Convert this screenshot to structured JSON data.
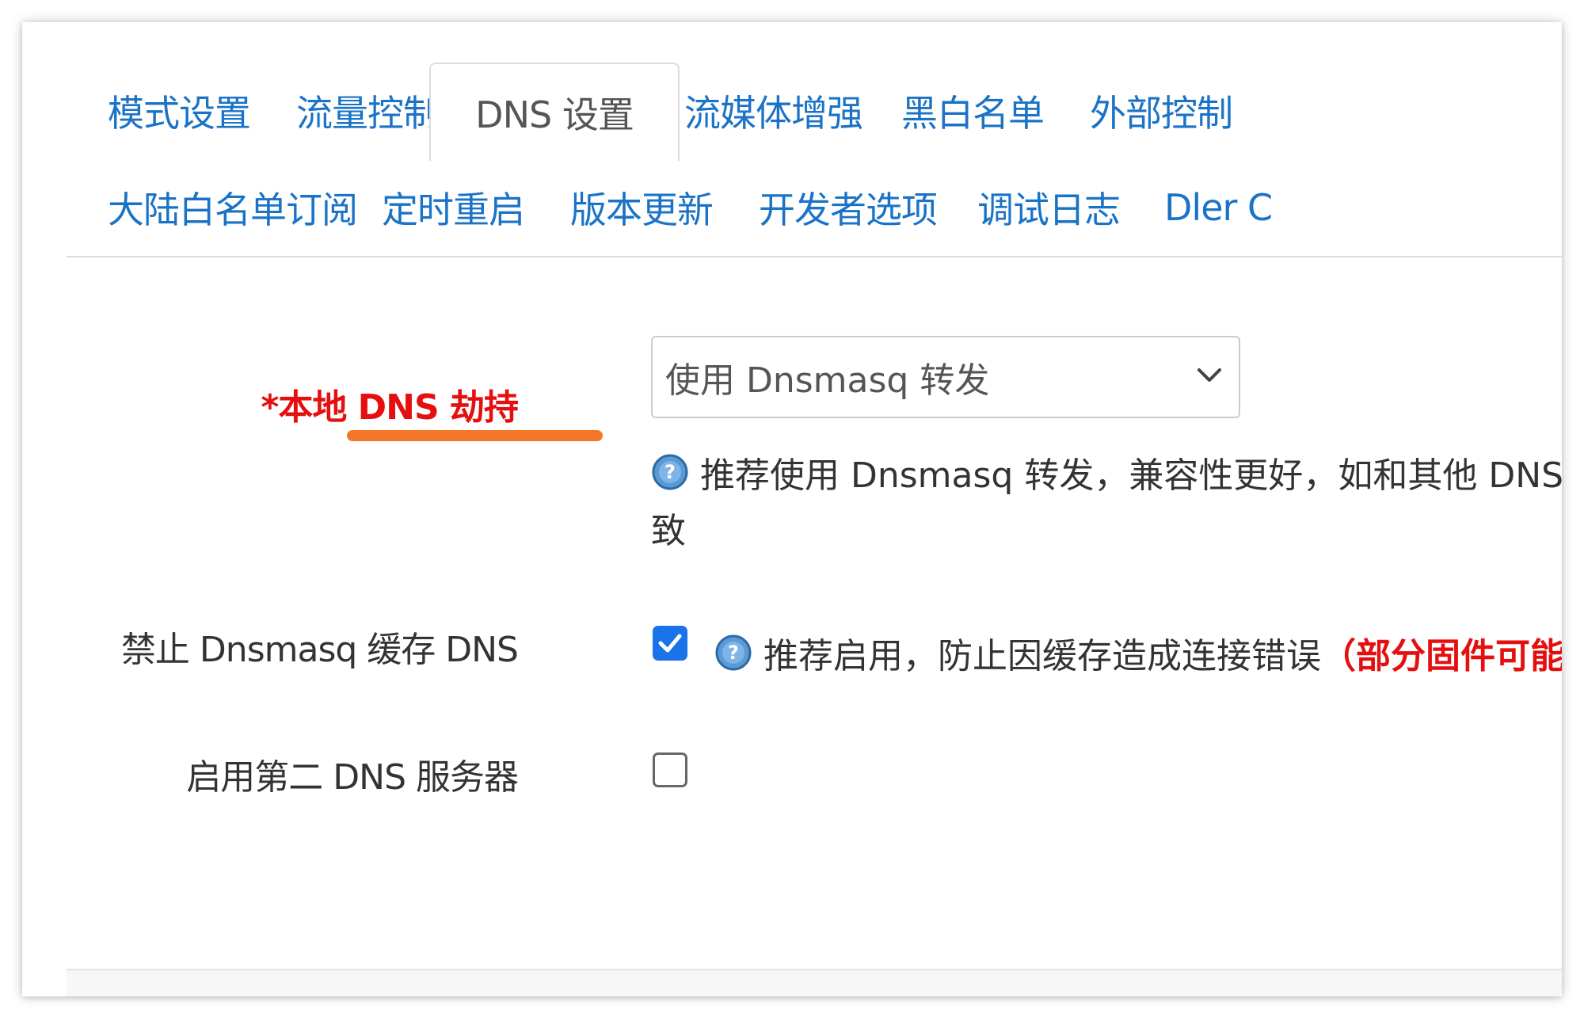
{
  "tabs_row1": [
    {
      "label": "模式设置",
      "active": false
    },
    {
      "label": "流量控制",
      "active": false
    },
    {
      "label": "DNS 设置",
      "active": true
    },
    {
      "label": "流媒体增强",
      "active": false
    },
    {
      "label": "黑白名单",
      "active": false
    },
    {
      "label": "外部控制",
      "active": false
    }
  ],
  "tabs_row2": [
    {
      "label": "大陆白名单订阅"
    },
    {
      "label": "定时重启"
    },
    {
      "label": "版本更新"
    },
    {
      "label": "开发者选项"
    },
    {
      "label": "调试日志"
    },
    {
      "label": "Dler C"
    }
  ],
  "fields": {
    "local_dns_hijack": {
      "label": "*本地 DNS 劫持",
      "select_value": "使用 Dnsmasq 转发",
      "help_line1": "推荐使用 Dnsmasq 转发，兼容性更好，如和其他 DNS",
      "help_line2": "致"
    },
    "disable_dnsmasq_cache": {
      "label": "禁止 Dnsmasq 缓存 DNS",
      "checked": true,
      "help_text": "推荐启用，防止因缓存造成连接错误",
      "help_warning": "（部分固件可能"
    },
    "enable_second_dns": {
      "label": "启用第二 DNS 服务器",
      "checked": false
    }
  },
  "icons": {
    "help": "question-mark-circle-icon",
    "dropdown": "chevron-down-icon",
    "checkmark": "checkmark-icon"
  },
  "colors": {
    "link_blue": "#1a73c7",
    "required_red": "#e50f0f",
    "highlight_orange": "#f5782a",
    "checkbox_blue": "#1a73e8"
  }
}
